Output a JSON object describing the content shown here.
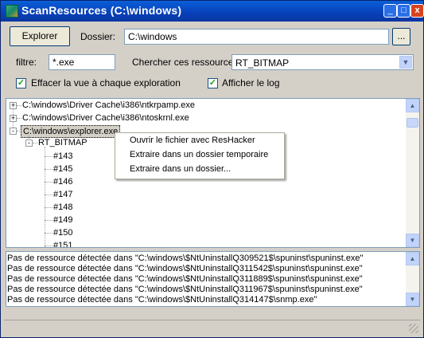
{
  "window": {
    "title": "ScanResources (C:\\windows)",
    "min_label": "_",
    "max_label": "□",
    "close_label": "x"
  },
  "toolbar": {
    "explore_button": "Explorer",
    "folder_label": "Dossier:",
    "folder_value": "C:\\windows",
    "browse_button": "...",
    "filter_label": "filtre:",
    "filter_value": "*.exe",
    "search_label": "Chercher ces ressources:",
    "resource_type": "RT_BITMAP",
    "clear_view_label": "Effacer la vue à chaque exploration",
    "clear_view_checked": true,
    "show_log_label": "Afficher le log",
    "show_log_checked": true
  },
  "tree": {
    "items": [
      {
        "label": "C:\\windows\\Driver Cache\\i386\\ntkrpamp.exe",
        "expander": "+"
      },
      {
        "label": "C:\\windows\\Driver Cache\\i386\\ntoskrnl.exe",
        "expander": "+"
      },
      {
        "label": "C:\\windows\\explorer.exe",
        "expander": "-"
      }
    ],
    "group": {
      "label": "RT_BITMAP",
      "expander": "-"
    },
    "resources": [
      "#143",
      "#145",
      "#146",
      "#147",
      "#148",
      "#149",
      "#150",
      "#151"
    ]
  },
  "context_menu": {
    "items": [
      "Ouvrir le fichier avec ResHacker",
      "Extraire dans un dossier temporaire",
      "Extraire dans un dossier..."
    ]
  },
  "log": {
    "lines": [
      "Pas de ressource détectée dans \"C:\\windows\\$NtUninstallQ309521$\\spuninst\\spuninst.exe\"",
      "Pas de ressource détectée dans \"C:\\windows\\$NtUninstallQ311542$\\spuninst\\spuninst.exe\"",
      "Pas de ressource détectée dans \"C:\\windows\\$NtUninstallQ311889$\\spuninst\\spuninst.exe\"",
      "Pas de ressource détectée dans \"C:\\windows\\$NtUninstallQ311967$\\spuninst\\spuninst.exe\"",
      "Pas de ressource détectée dans \"C:\\windows\\$NtUninstallQ314147$\\snmp.exe\""
    ]
  },
  "icons": {
    "app": "app-icon",
    "scroll_up": "▲",
    "scroll_down": "▼",
    "dropdown": "▼",
    "check": "✓"
  }
}
